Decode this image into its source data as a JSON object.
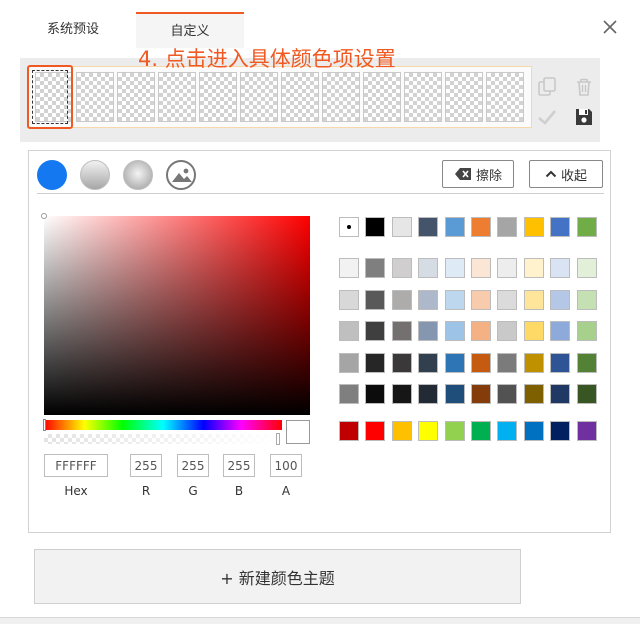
{
  "tabs": [
    {
      "label": "系统预设",
      "active": false
    },
    {
      "label": "自定义",
      "active": true
    }
  ],
  "accent_color": "#f05a22",
  "step_hint": "4. 点击进入具体颜色项设置",
  "theme_slots_count": 12,
  "strip_icons": [
    "copy-icon",
    "trash-icon",
    "check-icon",
    "save-icon"
  ],
  "fill_types": [
    "solid-fill",
    "linear-gradient-fill",
    "radial-gradient-fill",
    "image-fill"
  ],
  "buttons": {
    "erase": "擦除",
    "collapse": "收起",
    "new_theme": "+ 新建颜色主题"
  },
  "picker": {
    "hex": "FFFFFF",
    "r": "255",
    "g": "255",
    "b": "255",
    "a": "100",
    "labels": {
      "hex": "Hex",
      "r": "R",
      "g": "G",
      "b": "B",
      "a": "A"
    }
  },
  "palette": {
    "row1": [
      "#ffffff",
      "#000000",
      "#e7e6e6",
      "#44546a",
      "#5b9bd5",
      "#ed7d31",
      "#a5a5a5",
      "#ffc000",
      "#4472c4",
      "#70ad47"
    ],
    "shades": [
      [
        "#f2f2f2",
        "#7f7f7f",
        "#d0cece",
        "#d6dce4",
        "#deebf6",
        "#fbe5d5",
        "#ededed",
        "#fff2cc",
        "#dae3f3",
        "#e2efd9"
      ],
      [
        "#d8d8d8",
        "#595959",
        "#aeabab",
        "#adb9ca",
        "#bdd7ee",
        "#f8cbad",
        "#dbdbdb",
        "#fee599",
        "#b4c7e7",
        "#c5e0b3"
      ],
      [
        "#bfbfbf",
        "#3f3f3f",
        "#757070",
        "#8496b0",
        "#9dc3e6",
        "#f4b183",
        "#c9c9c9",
        "#ffd965",
        "#8eaadb",
        "#a8d08d"
      ],
      [
        "#a5a5a5",
        "#262626",
        "#3a3838",
        "#323f4f",
        "#2e75b5",
        "#c55a11",
        "#7b7b7b",
        "#bf9000",
        "#2f5496",
        "#538135"
      ],
      [
        "#7f7f7f",
        "#0c0c0c",
        "#171616",
        "#222a35",
        "#1e4e79",
        "#843c0b",
        "#525252",
        "#7f6000",
        "#1f3864",
        "#375623"
      ]
    ],
    "standard": [
      "#c00000",
      "#ff0000",
      "#ffc000",
      "#ffff00",
      "#92d050",
      "#00b050",
      "#00b0f0",
      "#0070c0",
      "#002060",
      "#7030a0"
    ]
  }
}
